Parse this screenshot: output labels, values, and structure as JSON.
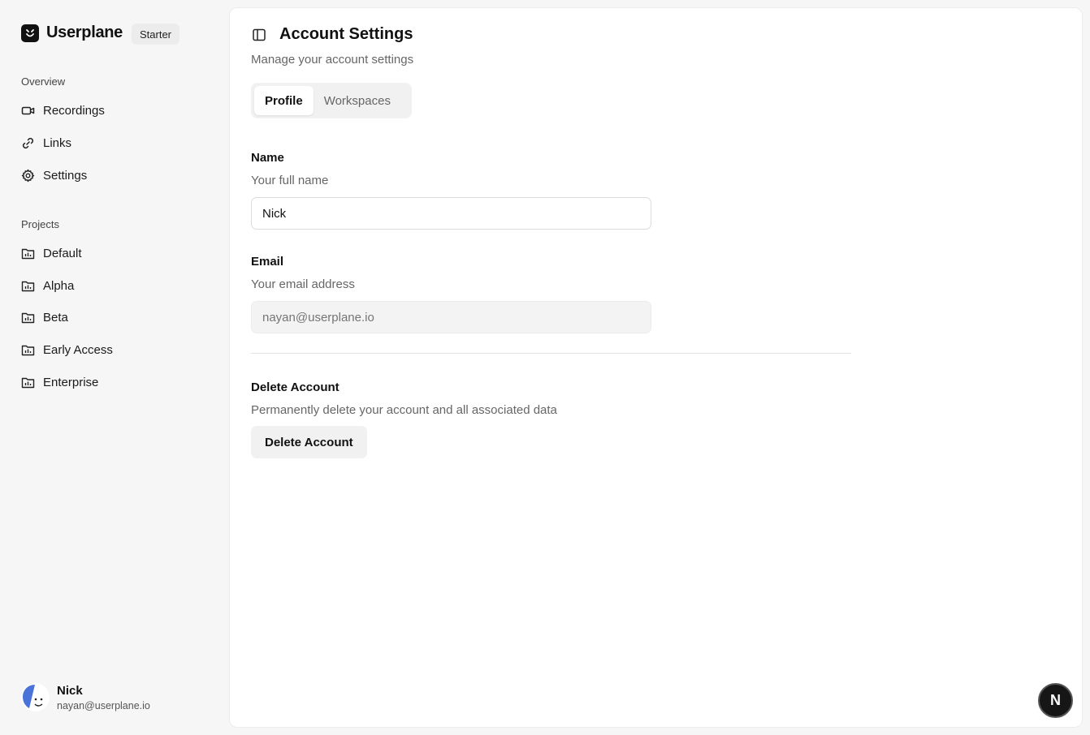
{
  "brand": {
    "name": "Userplane",
    "plan": "Starter"
  },
  "sidebar": {
    "overview_label": "Overview",
    "overview_items": [
      {
        "label": "Recordings",
        "icon": "video-camera-icon"
      },
      {
        "label": "Links",
        "icon": "link-icon"
      },
      {
        "label": "Settings",
        "icon": "gear-icon"
      }
    ],
    "projects_label": "Projects",
    "projects": [
      {
        "label": "Default",
        "icon": "folder-chart-icon"
      },
      {
        "label": "Alpha",
        "icon": "folder-chart-icon"
      },
      {
        "label": "Beta",
        "icon": "folder-chart-icon"
      },
      {
        "label": "Early Access",
        "icon": "folder-chart-icon"
      },
      {
        "label": "Enterprise",
        "icon": "folder-chart-icon"
      }
    ],
    "user": {
      "name": "Nick",
      "email": "nayan@userplane.io"
    }
  },
  "main": {
    "title": "Account Settings",
    "subtitle": "Manage your account settings",
    "tabs": [
      {
        "label": "Profile",
        "active": true
      },
      {
        "label": "Workspaces",
        "active": false
      }
    ],
    "name_field": {
      "label": "Name",
      "description": "Your full name",
      "value": "Nick"
    },
    "email_field": {
      "label": "Email",
      "description": "Your email address",
      "placeholder": "nayan@userplane.io",
      "disabled": true
    },
    "delete": {
      "title": "Delete Account",
      "description": "Permanently delete your account and all associated data",
      "button_label": "Delete Account"
    }
  },
  "fab": {
    "label": "N"
  },
  "colors": {
    "accent": "#111111",
    "avatar_blue": "#4a73d9",
    "muted_text": "#666666"
  }
}
